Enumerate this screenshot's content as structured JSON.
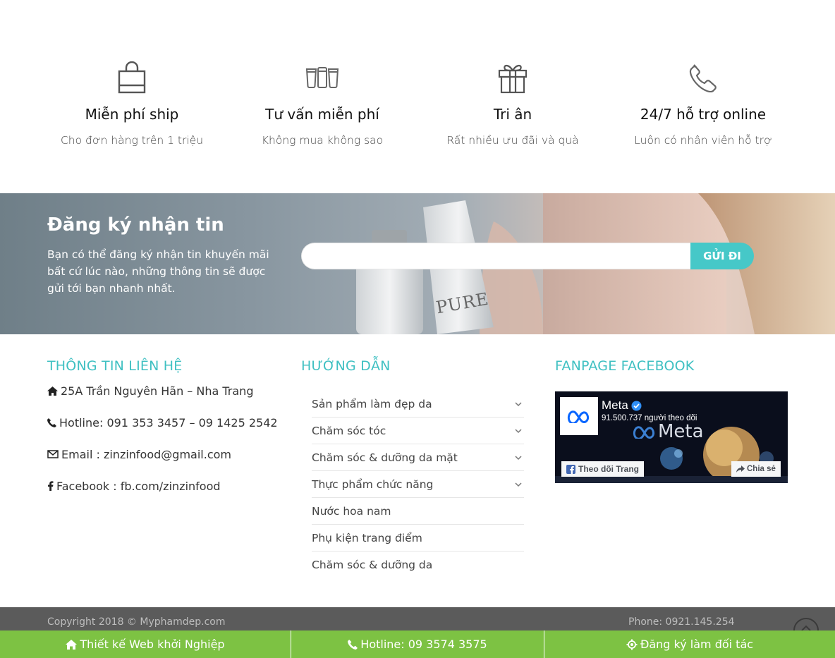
{
  "features": [
    {
      "icon": "shopping-bag-icon",
      "title": "Miễn phí ship",
      "desc": "Cho đơn hàng trên 1 triệu"
    },
    {
      "icon": "bottles-icon",
      "title": "Tư vấn miễn phí",
      "desc": "Không mua không sao"
    },
    {
      "icon": "gift-icon",
      "title": "Tri ân",
      "desc": "Rất nhiều ưu đãi và quà"
    },
    {
      "icon": "phone-icon",
      "title": "24/7 hỗ trợ online",
      "desc": "Luôn có nhân viên hỗ trợ"
    }
  ],
  "newsletter": {
    "title": "Đăng ký nhận tin",
    "desc": "Bạn có thể đăng ký nhận tin khuyến mãi bất cứ lúc nào, những thông tin sẽ được gửi tới bạn nhanh nhất.",
    "input_value": "",
    "button_label": "GỬI ĐI",
    "product_label": "PURE"
  },
  "contact": {
    "title": "THÔNG TIN LIÊN HỆ",
    "address": "25A Trần Nguyên Hãn – Nha Trang",
    "hotline": "Hotline: 091 353 3457 – 09 1425 2542",
    "email": "Email : zinzinfood@gmail.com",
    "facebook": "Facebook : fb.com/zinzinfood"
  },
  "guide": {
    "title": "HƯỚNG DẪN",
    "items": [
      {
        "label": "Sản phẩm làm đẹp da",
        "has_children": true
      },
      {
        "label": "Chăm sóc tóc",
        "has_children": true
      },
      {
        "label": "Chăm sóc & dưỡng da mặt",
        "has_children": true
      },
      {
        "label": "Thực phẩm chức năng",
        "has_children": true
      },
      {
        "label": "Nước hoa nam",
        "has_children": false
      },
      {
        "label": "Phụ kiện trang điểm",
        "has_children": false
      },
      {
        "label": "Chăm sóc & dưỡng da",
        "has_children": false
      }
    ]
  },
  "fanpage": {
    "title": "FANPAGE FACEBOOK",
    "page_name": "Meta",
    "followers": "91.500.737 người theo dõi",
    "cover_text": "Meta",
    "follow_label": "Theo dõi Trang",
    "share_label": "Chia sẻ"
  },
  "footer": {
    "copyright": "Copyright 2018 © Myphamdep.com",
    "phone": "Phone: 0921.145.254"
  },
  "bottom_bar": [
    {
      "icon": "home-icon",
      "label": "Thiết kế Web khởi Nghiệp"
    },
    {
      "icon": "phone-icon",
      "label": "Hotline: 09 3574 3575"
    },
    {
      "icon": "gear-icon",
      "label": "Đăng ký làm đối tác"
    }
  ],
  "colors": {
    "accent": "#3fc0c2",
    "button": "#46c8c8",
    "green_bar": "#7dc243",
    "copy_bar": "#5b5b5b"
  }
}
